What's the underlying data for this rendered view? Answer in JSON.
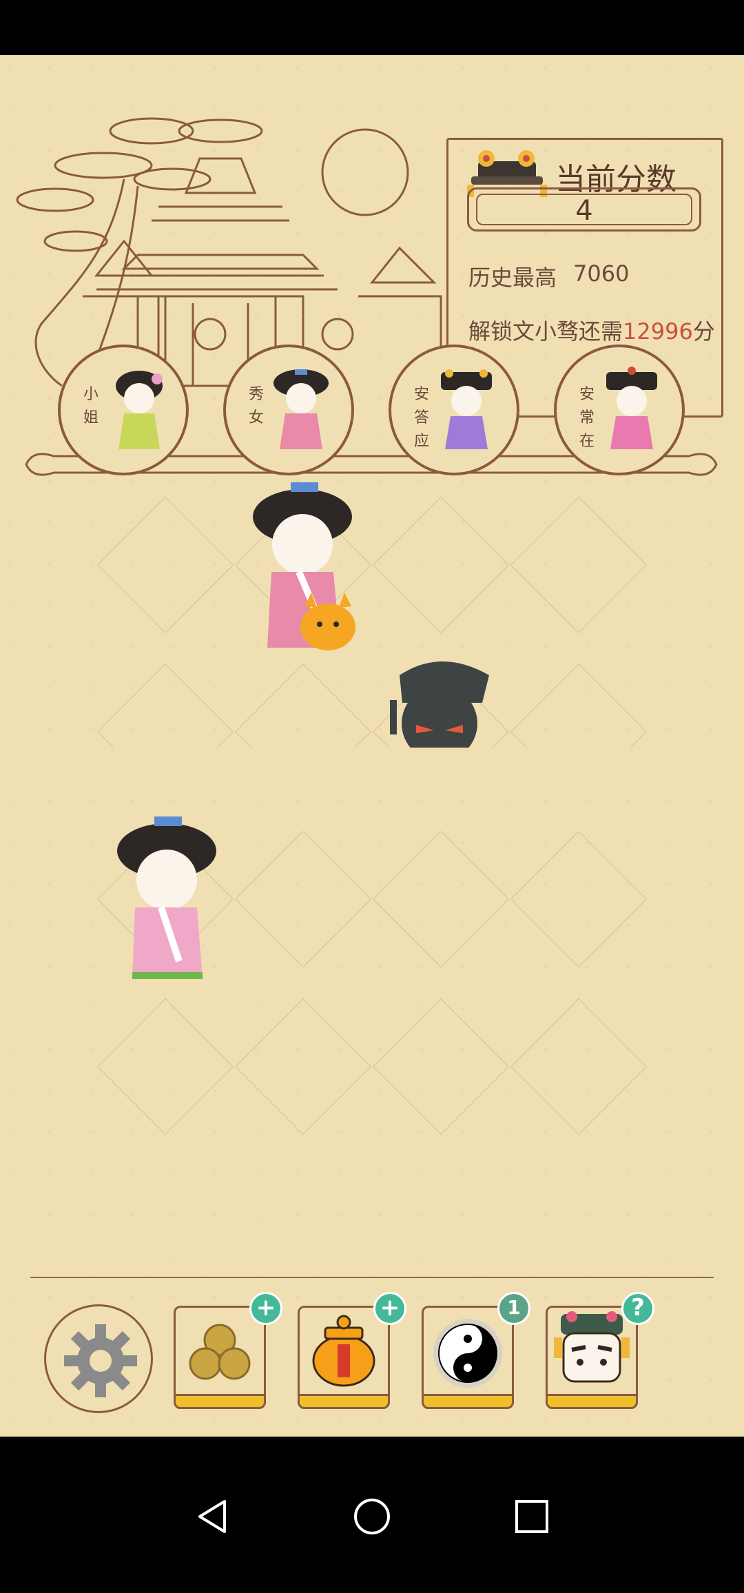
{
  "score_panel": {
    "title": "当前分数",
    "current_score": "4",
    "history_label": "历史最高",
    "history_value": "7060",
    "unlock_prefix": "解锁文小骛还需",
    "unlock_points": "12996",
    "unlock_suffix": "分"
  },
  "ranks": [
    {
      "label": "小姐"
    },
    {
      "label": "秀女"
    },
    {
      "label": "安答应"
    },
    {
      "label": "安常在"
    }
  ],
  "toolbar": {
    "settings_icon": "gear-icon",
    "coins_badge": "+",
    "jar_badge": "+",
    "yinyang_badge": "1",
    "eunuch_badge": "?"
  },
  "colors": {
    "background": "#f1dfb4",
    "outline": "#8b5a3c",
    "accent_red": "#c8503c",
    "badge_green": "#46b89a"
  }
}
